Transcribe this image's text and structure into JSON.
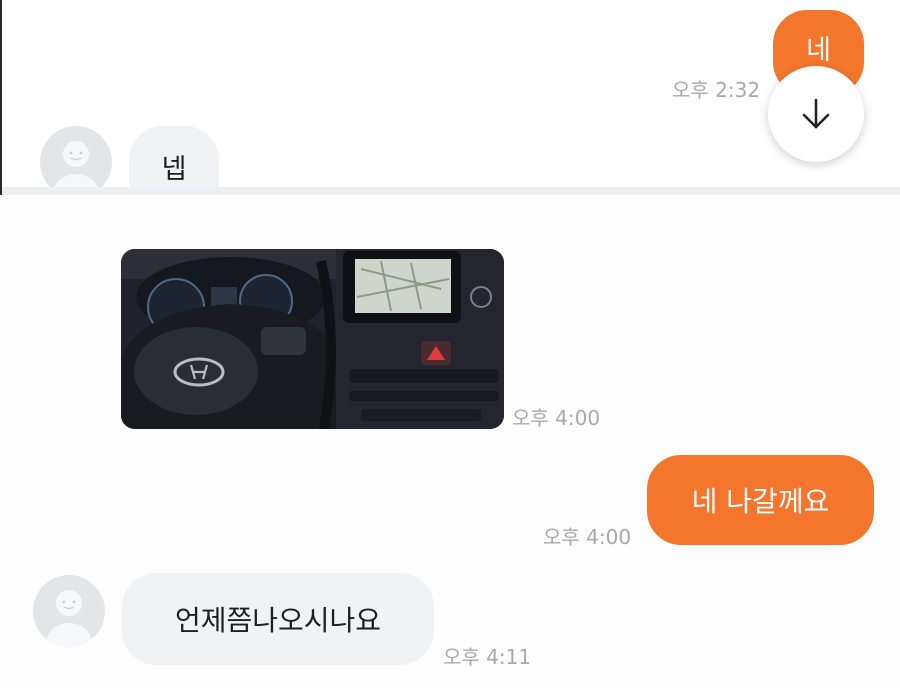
{
  "top": {
    "out_bubble_text": "네",
    "out_timestamp": "오후 2:32",
    "in_bubble_text": "넵",
    "scroll_icon": "arrow-down-icon"
  },
  "bottom": {
    "photo_timestamp": "오후 4:00",
    "out_bubble_text": "네 나갈께요",
    "out_timestamp": "오후 4:00",
    "in_bubble_text": "언제쯤나오시나요",
    "in_timestamp": "오후 4:11"
  },
  "colors": {
    "accent": "#f4762d",
    "incoming_bubble": "#f1f2f4",
    "timestamp": "#a9a9a9"
  }
}
